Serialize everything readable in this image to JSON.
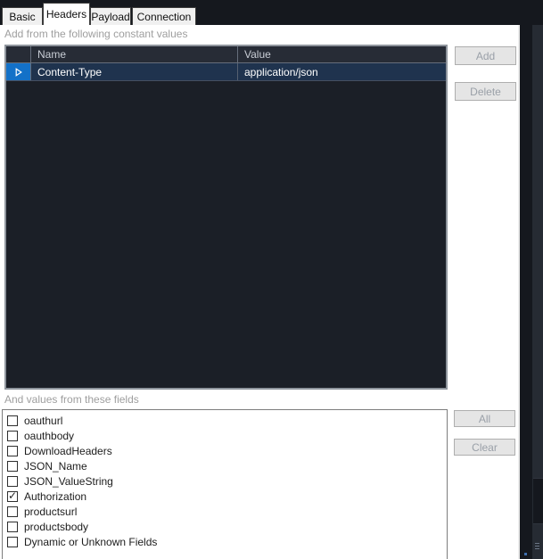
{
  "tabs": [
    {
      "label": "Basic",
      "active": false
    },
    {
      "label": "Headers",
      "active": true
    },
    {
      "label": "Payload",
      "active": false
    },
    {
      "label": "Connection",
      "active": false
    }
  ],
  "constants_section": {
    "label": "Add from the following constant values",
    "grid": {
      "columns": {
        "name": "Name",
        "value": "Value"
      },
      "rows": [
        {
          "name": "Content-Type",
          "value": "application/json",
          "selected": true
        }
      ]
    },
    "add_button": "Add",
    "delete_button": "Delete"
  },
  "fields_section": {
    "label": "And values from these fields",
    "items": [
      {
        "label": "oauthurl",
        "checked": false
      },
      {
        "label": "oauthbody",
        "checked": false
      },
      {
        "label": "DownloadHeaders",
        "checked": false
      },
      {
        "label": "JSON_Name",
        "checked": false
      },
      {
        "label": "JSON_ValueString",
        "checked": false
      },
      {
        "label": "Authorization",
        "checked": true
      },
      {
        "label": "productsurl",
        "checked": false
      },
      {
        "label": "productsbody",
        "checked": false
      },
      {
        "label": "Dynamic or Unknown Fields",
        "checked": false
      }
    ],
    "all_button": "All",
    "clear_button": "Clear"
  },
  "colors": {
    "selected_row": "#1f334e",
    "row_selector_blue": "#1371c8",
    "grid_panel_dark": "#1b1f27",
    "window_dark": "#15181e"
  }
}
